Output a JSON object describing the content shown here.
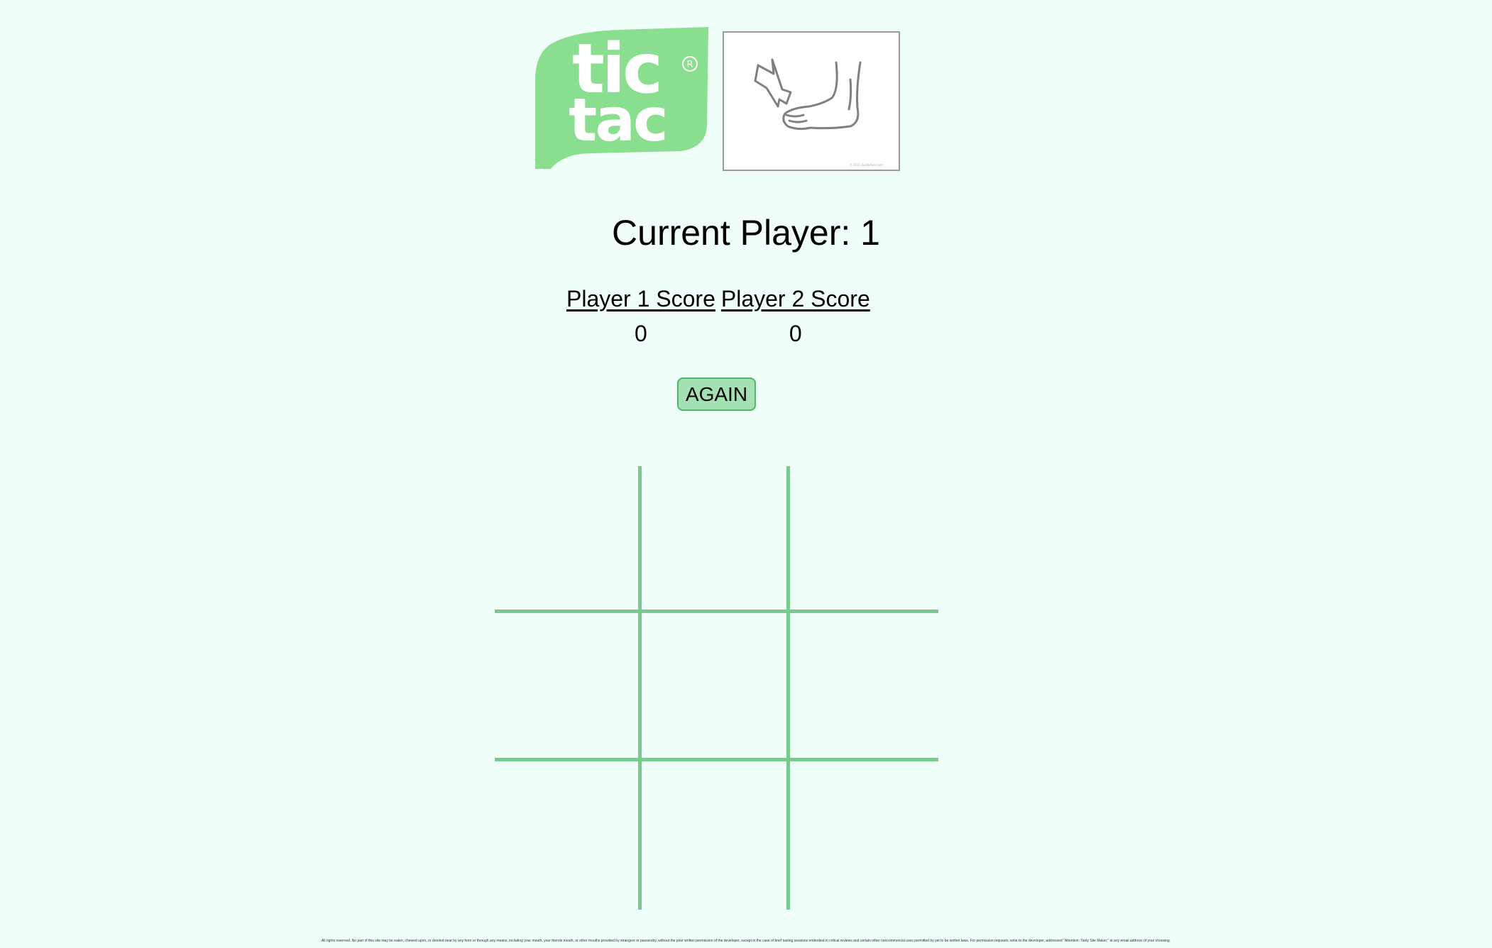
{
  "header": {
    "logo_text_line1": "tic",
    "logo_text_line2": "tac",
    "logo_registered": "®",
    "foot_image_credit": "© 2011 doctorfoot.com",
    "brand_color": "#8ade8f"
  },
  "game": {
    "current_player_label": "Current Player: 1",
    "player1_score_label": "Player 1 Score",
    "player2_score_label": "Player 2 Score",
    "player1_score": "0",
    "player2_score": "0",
    "again_label": "AGAIN",
    "board": [
      "",
      "",
      "",
      "",
      "",
      "",
      "",
      "",
      ""
    ],
    "grid_color": "#46b45f"
  },
  "footer": {
    "legal_text": "All rights reserved. No part of this site may be eaten, chewed upon, or drooled near by any form or through any means, including your mouth, your friends mouth, or other mouths provided by strangers or passersby, without the prior written permission of the developer, except in the case of brief tasting sessions embodied in critical reviews and certain other noncommercial uses permitted by yet to be written laws. For permission requests, write to the developer, addressed \"Attention: Tasty Site Maker,\" at any email address of your choosing."
  }
}
